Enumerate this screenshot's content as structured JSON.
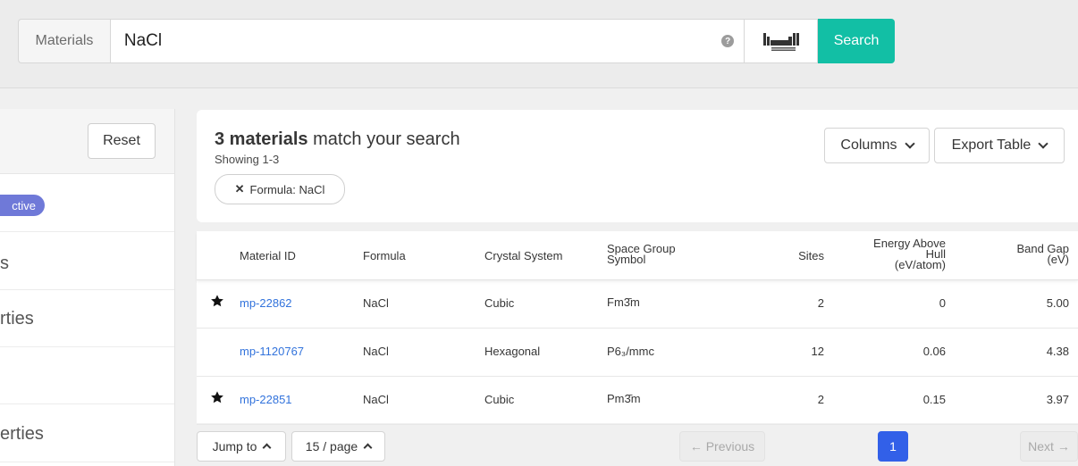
{
  "search": {
    "label": "Materials",
    "value": "NaCl",
    "help_glyph": "?",
    "button_label": "Search"
  },
  "sidebar": {
    "reset_label": "Reset",
    "pill_text": "ctive",
    "items": [
      "s",
      "rties",
      "",
      "erties"
    ]
  },
  "results": {
    "count": "3 materials",
    "title_rest": " match your search",
    "showing": "Showing 1-3",
    "filter_chip": "Formula: NaCl",
    "columns_label": "Columns",
    "export_label": "Export Table"
  },
  "table": {
    "headers": {
      "material_id": "Material ID",
      "formula": "Formula",
      "crystal_system": "Crystal System",
      "space_group_l1": "Space Group",
      "space_group_l2": "Symbol",
      "sites": "Sites",
      "energy_l1": "Energy Above",
      "energy_l2": "Hull",
      "energy_l3": "(eV/atom)",
      "bandgap_l1": "Band Gap",
      "bandgap_l2": "(eV)"
    },
    "rows": [
      {
        "starred": true,
        "id": "mp-22862",
        "formula": "NaCl",
        "crystal": "Cubic",
        "sg": "Fm3̄m",
        "sites": "2",
        "energy": "0",
        "gap": "5.00"
      },
      {
        "starred": false,
        "id": "mp-1120767",
        "formula": "NaCl",
        "crystal": "Hexagonal",
        "sg": "P6₃/mmc",
        "sites": "12",
        "energy": "0.06",
        "gap": "4.38"
      },
      {
        "starred": true,
        "id": "mp-22851",
        "formula": "NaCl",
        "crystal": "Cubic",
        "sg": "Pm3̄m",
        "sites": "2",
        "energy": "0.15",
        "gap": "3.97"
      }
    ]
  },
  "pagination": {
    "jump_label": "Jump to",
    "per_page_label": "15 / page",
    "previous_label": "← Previous",
    "current_page": "1",
    "next_label": "Next →"
  },
  "colors": {
    "accent_teal": "#12bfa5",
    "link_blue": "#3273dc",
    "page_blue": "#3260e8",
    "pill_purple": "#6f79d8"
  }
}
